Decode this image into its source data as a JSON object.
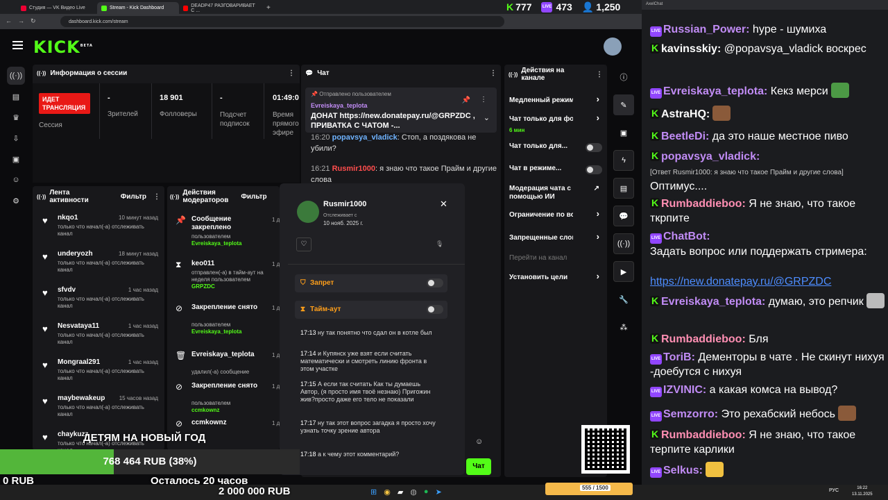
{
  "browser": {
    "tabs": [
      "Студия — VK Видео Live",
      "Stream - Kick Dashboard",
      "DEADP47 РАЗГОВАРИВАЕТ С ..."
    ],
    "url": "dashboard.kick.com/stream"
  },
  "stats": {
    "kick": "777",
    "live": "473",
    "viewers": "1,250"
  },
  "app": {
    "logo": "KICK",
    "logo_tag": "BETA"
  },
  "session": {
    "title": "Информация о сессии",
    "live_label": "ИДЕТ ТРАНСЛЯЦИЯ",
    "session_label": "Сессия",
    "viewers_value": "-",
    "viewers_label": "Зрителей",
    "followers_value": "18 901",
    "followers_label": "Фолловеры",
    "subs_value": "-",
    "subs_label": "Подсчет подписок",
    "time_value": "01:49:0",
    "time_label": "Время прямого эфире"
  },
  "feed": {
    "title": "Лента активности",
    "filter": "Фильтр",
    "items": [
      {
        "name": "nkqo1",
        "time": "10 минут назад",
        "desc": "только что начал(-а) отслеживать канал"
      },
      {
        "name": "underyozh",
        "time": "18 минут назад",
        "desc": "только что начал(-а) отслеживать канал"
      },
      {
        "name": "sfvdv",
        "time": "1 час назад",
        "desc": "только что начал(-а) отслеживать канал"
      },
      {
        "name": "Nesvataya11",
        "time": "1 час назад",
        "desc": "только что начал(-а) отслеживать канал"
      },
      {
        "name": "Mongraal291",
        "time": "1 час назад",
        "desc": "только что начал(-а) отслеживать канал"
      },
      {
        "name": "maybewakeup",
        "time": "15 часов назад",
        "desc": "только что начал(-а) отслеживать канал"
      },
      {
        "name": "chaykuzz",
        "time": "",
        "desc": "только что начал(-а) отслеживать канал"
      }
    ]
  },
  "mod": {
    "title": "Действия модераторов",
    "filter": "Фильтр",
    "items": [
      {
        "title": "Сообщение закреплено",
        "sub": "пользователем",
        "user": "Evreiskaya_teplota",
        "time": "1 д"
      },
      {
        "title": "keo011",
        "sub": "отправлен(-а) в тайм-аут на неделя пользователем",
        "user": "GRPZDC",
        "time": "1 день н"
      },
      {
        "title": "Закрепление снято",
        "sub": "пользователем",
        "user": "Evreiskaya_teplota",
        "time": "1 д"
      },
      {
        "title": "Evreiskaya_teplota",
        "sub": "удалил(-а) сообщение",
        "user": "",
        "time": "1 д"
      },
      {
        "title": "Закрепление снято",
        "sub": "пользователем",
        "user": "ccmkownz",
        "time": "1 д"
      },
      {
        "title": "ccmkownz",
        "sub": "",
        "user": "",
        "time": "1 д"
      }
    ]
  },
  "chat": {
    "title": "Чат",
    "pinned_by": "Отправлено пользователем",
    "pinned_user": "Evreiskaya_teplota",
    "pinned_text": "ДОНАТ https://new.donatepay.ru/@GRPZDC , ПРИВАТКА С ЧАТОМ -...",
    "lines": [
      {
        "ts": "16:20",
        "user": "popavsya_vladick",
        "text": ": Стоп, а поздякова не убили?"
      },
      {
        "ts": "16:21",
        "user": "Rusmir1000",
        "text": ": я знаю что такое Прайм и другие слова"
      }
    ],
    "send": "Чат"
  },
  "settings": {
    "title": "Действия на канале",
    "items": [
      "Медленный режим",
      "Чат только для фолло",
      "Чат только для...",
      "Чат в режиме...",
      "Модерация чата с помощью ИИ",
      "Ограничение по возра",
      "Запрещенные слова",
      "Перейти на канал",
      "Установить цели"
    ],
    "follow_sub": "6 мин"
  },
  "popup": {
    "user": "Rusmir1000",
    "follow_label": "Отслеживает с",
    "follow_date": "10 нояб. 2025 г.",
    "ban": "Запрет",
    "timeout": "Тайм-аут",
    "log": [
      {
        "ts": "17:13",
        "text": "ну так понятно что сдал он в котле был"
      },
      {
        "ts": "17:14",
        "text": "и Купянск уже взят если считать математически и смотреть линию фронта в этом участке"
      },
      {
        "ts": "17:15",
        "text": "А если так считать Как ты думаешь Автор, (я просто имя твоё незнаю) Пригожин жив?просто даже его тело не показали"
      },
      {
        "ts": "17:17",
        "text": "ну так этот вопрос загадка я просто хочу узнать точку зрение автора"
      },
      {
        "ts": "17:18",
        "text": "а к чему этот комментарий?"
      }
    ]
  },
  "rchat": {
    "header": "AxelChat",
    "lines": [
      {
        "badge": "live",
        "user": "Russian_Power",
        "color": "#c18cf5",
        "text": " hype - шумиха"
      },
      {
        "badge": "k",
        "user": "kavinsskiy",
        "color": "#ffffff",
        "text": " @popavsya_vladick воскрес"
      },
      {
        "badge": "live",
        "user": "Evreiskaya_teplota",
        "color": "#c18cf5",
        "text": " Кекз мерси"
      },
      {
        "badge": "k",
        "user": "AstraHQ",
        "color": "#ffffff",
        "text": ""
      },
      {
        "badge": "k",
        "user": "BeetleDi",
        "color": "#c18cf5",
        "text": " да это наше местное пиво"
      },
      {
        "badge": "k",
        "user": "popavsya_vladick",
        "color": "#c18cf5",
        "text": ""
      },
      {
        "badge": "",
        "user": "",
        "color": "#fff",
        "text": "[Ответ Rusmir1000: я знаю что такое Прайм и другие слова]"
      },
      {
        "badge": "",
        "user": "",
        "color": "#fff",
        "text": "Оптимус...."
      },
      {
        "badge": "k",
        "user": "Rumbaddieboo",
        "color": "#ff8fb3",
        "text": " Я не знаю, что такое ткрпите"
      },
      {
        "badge": "live",
        "user": "ChatBot",
        "color": "#c18cf5",
        "text": ""
      },
      {
        "badge": "",
        "user": "",
        "color": "#fff",
        "text": "Задать вопрос или поддержать стримера:"
      },
      {
        "badge": "",
        "user": "",
        "color": "#fff",
        "text": "https://new.donatepay.ru/@GRPZDC"
      },
      {
        "badge": "k",
        "user": "Evreiskaya_teplota",
        "color": "#c18cf5",
        "text": " думаю, это репчик"
      },
      {
        "badge": "k",
        "user": "Rumbaddieboo",
        "color": "#ff8fb3",
        "text": " Бля"
      },
      {
        "badge": "live",
        "user": "ToriB",
        "color": "#c18cf5",
        "text": " Дементоры в чате . Не скинут нихуя -доебутся с нихуя"
      },
      {
        "badge": "live",
        "user": "IZVINIC",
        "color": "#c18cf5",
        "text": " а какая комса на вывод?"
      },
      {
        "badge": "live",
        "user": "Semzorro",
        "color": "#c18cf5",
        "text": " Это рехабский небось"
      },
      {
        "badge": "k",
        "user": "Rumbaddieboo",
        "color": "#ff8fb3",
        "text": " Я не знаю, что такое терпите карлики"
      },
      {
        "badge": "live",
        "user": "Selkus",
        "color": "#c18cf5",
        "text": ""
      }
    ]
  },
  "goal": {
    "title": "ДЕТЯМ НА НОВЫЙ ГОД",
    "progress_text": "768 464 RUB (38%)",
    "progress": 0.38,
    "start": "0 RUB",
    "left": "Осталось 20 часов",
    "target": "2 000 000 RUB"
  },
  "taskbar": {
    "lang": "РУС",
    "time": "16:22",
    "date": "13.11.2025",
    "meme": "555 / 1500"
  }
}
